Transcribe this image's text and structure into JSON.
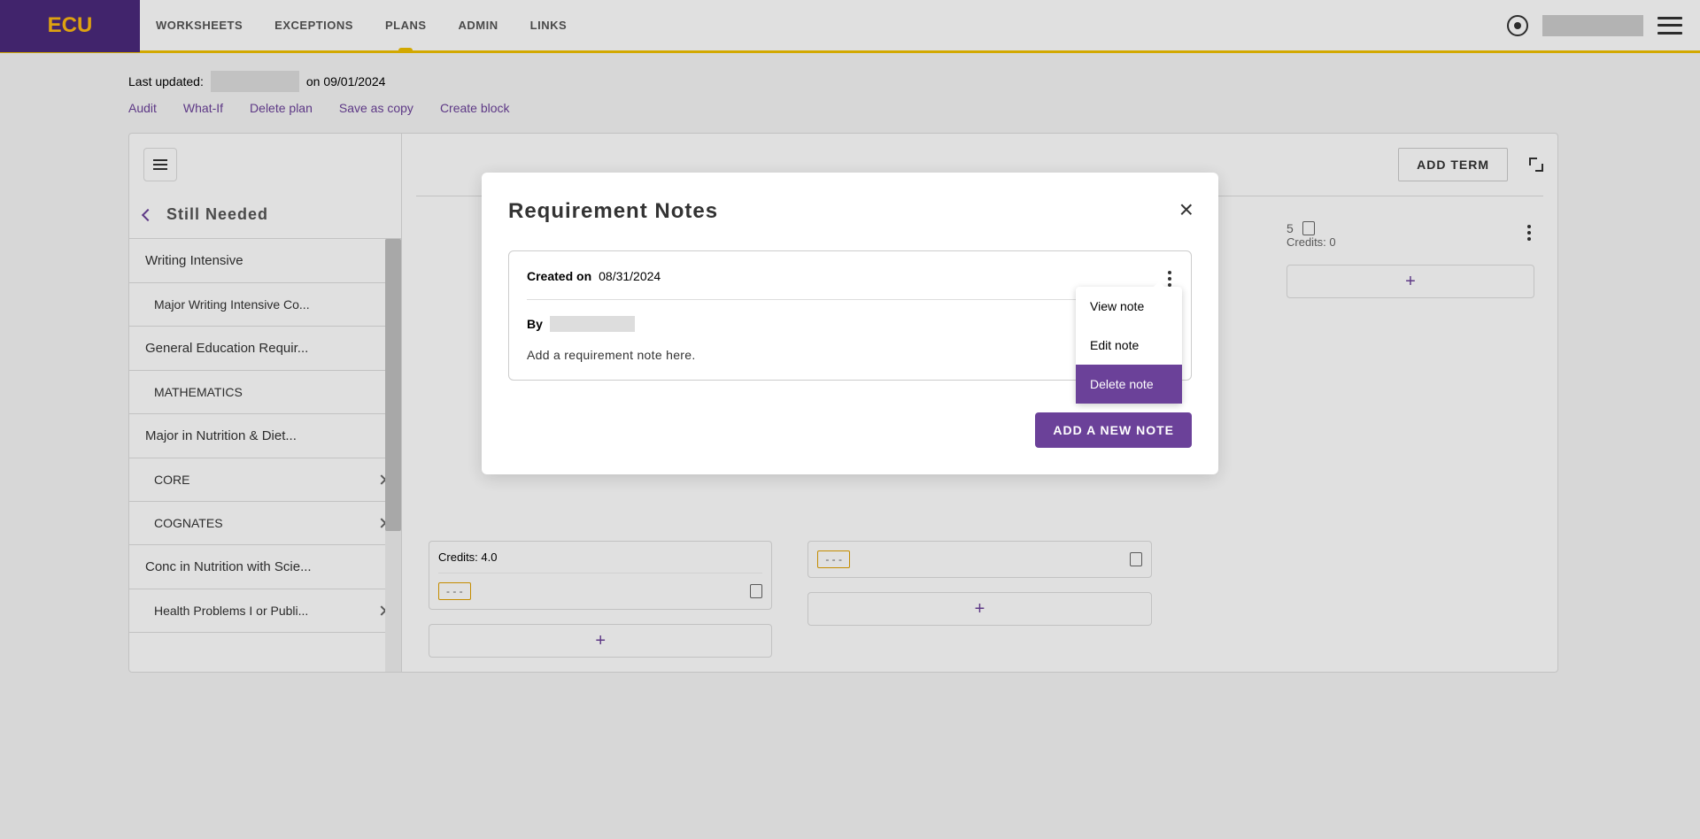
{
  "header": {
    "logo_text": "ECU",
    "nav": {
      "worksheets": "WORKSHEETS",
      "exceptions": "EXCEPTIONS",
      "plans": "PLANS",
      "admin": "ADMIN",
      "links": "LINKS"
    }
  },
  "update_info": {
    "label": "Last updated:",
    "on_text": "on 09/01/2024"
  },
  "actions": {
    "audit": "Audit",
    "whatif": "What-If",
    "delete_plan": "Delete plan",
    "save_copy": "Save as copy",
    "create_block": "Create block"
  },
  "sidebar": {
    "title": "Still Needed",
    "items": [
      {
        "label": "Writing Intensive",
        "sub": false,
        "chevron": false
      },
      {
        "label": "Major Writing Intensive Co...",
        "sub": true,
        "chevron": false
      },
      {
        "label": "General Education Requir...",
        "sub": false,
        "chevron": false
      },
      {
        "label": "MATHEMATICS",
        "sub": true,
        "chevron": false
      },
      {
        "label": "Major in Nutrition & Diet...",
        "sub": false,
        "chevron": false
      },
      {
        "label": "CORE",
        "sub": true,
        "chevron": true
      },
      {
        "label": "COGNATES",
        "sub": true,
        "chevron": true
      },
      {
        "label": "Conc in Nutrition with Scie...",
        "sub": false,
        "chevron": false
      },
      {
        "label": "Health Problems I or Publi...",
        "sub": true,
        "chevron": true
      }
    ]
  },
  "main": {
    "add_term": "ADD TERM",
    "term": {
      "credits_label": "Credits:",
      "credits_value": "0"
    },
    "card1": {
      "credits": "Credits: 4.0",
      "dashes": "- - -"
    },
    "card2": {
      "dashes": "- - -"
    }
  },
  "modal": {
    "title": "Requirement Notes",
    "created_label": "Created on",
    "created_date": "08/31/2024",
    "by_label": "By",
    "note_body": "Add a requirement note here.",
    "menu": {
      "view": "View note",
      "edit": "Edit note",
      "delete": "Delete note"
    },
    "add_btn": "ADD A NEW NOTE"
  }
}
